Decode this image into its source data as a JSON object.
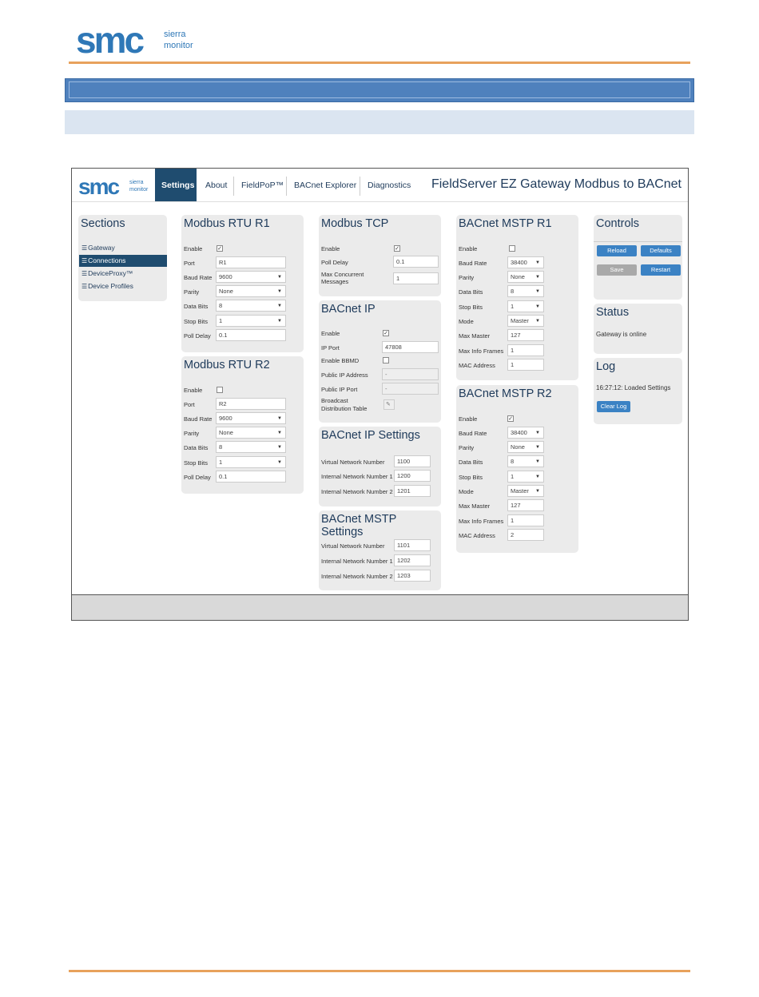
{
  "doc": {
    "logo_text": "smc",
    "logo_sub1": "sierra",
    "logo_sub2": "monitor"
  },
  "app": {
    "logo_text": "smc",
    "logo_sub1": "sierra",
    "logo_sub2": "monitor",
    "title": "FieldServer EZ Gateway Modbus to BACnet",
    "nav": [
      "Settings",
      "About",
      "FieldPoP™",
      "BACnet Explorer",
      "Diagnostics"
    ]
  },
  "sections": {
    "title": "Sections",
    "items": [
      "Gateway",
      "Connections",
      "DeviceProxy™",
      "Device Profiles"
    ]
  },
  "rtu1": {
    "title": "Modbus RTU R1",
    "labels": [
      "Enable",
      "Port",
      "Baud Rate",
      "Parity",
      "Data Bits",
      "Stop Bits",
      "Poll Delay"
    ],
    "enable": "✓",
    "port": "R1",
    "baud": "9600",
    "parity": "None",
    "data_bits": "8",
    "stop_bits": "1",
    "poll_delay": "0.1"
  },
  "rtu2": {
    "title": "Modbus RTU R2",
    "labels": [
      "Enable",
      "Port",
      "Baud Rate",
      "Parity",
      "Data Bits",
      "Stop Bits",
      "Poll Delay"
    ],
    "enable": "",
    "port": "R2",
    "baud": "9600",
    "parity": "None",
    "data_bits": "8",
    "stop_bits": "1",
    "poll_delay": "0.1"
  },
  "tcp": {
    "title": "Modbus TCP",
    "labels": [
      "Enable",
      "Poll Delay",
      "Max Concurrent",
      "Messages"
    ],
    "enable": "✓",
    "poll_delay": "0.1",
    "max_concurrent": "1"
  },
  "bip": {
    "title": "BACnet IP",
    "labels": [
      "Enable",
      "IP Port",
      "Enable BBMD",
      "Public IP Address",
      "Public IP Port",
      "Broadcast",
      "Distribution Table"
    ],
    "enable": "✓",
    "ip_port": "47808",
    "bbmd": "",
    "public_ip": "-",
    "public_port": "-",
    "bdt": "✎"
  },
  "bips": {
    "title": "BACnet IP Settings",
    "labels": [
      "Virtual Network Number",
      "Internal Network Number 1",
      "Internal Network Number 2"
    ],
    "values": [
      "1100",
      "1200",
      "1201"
    ]
  },
  "bms": {
    "title": "BACnet MSTP Settings",
    "labels": [
      "Virtual Network Number",
      "Internal Network Number 1",
      "Internal Network Number 2"
    ],
    "values": [
      "1101",
      "1202",
      "1203"
    ]
  },
  "mstp1": {
    "title": "BACnet MSTP R1",
    "labels": [
      "Enable",
      "Baud Rate",
      "Parity",
      "Data Bits",
      "Stop Bits",
      "Mode",
      "Max Master",
      "Max Info Frames",
      "MAC Address"
    ],
    "enable": "",
    "baud": "38400",
    "parity": "None",
    "data_bits": "8",
    "stop_bits": "1",
    "mode": "Master",
    "max_master": "127",
    "max_info": "1",
    "mac": "1"
  },
  "mstp2": {
    "title": "BACnet MSTP R2",
    "labels": [
      "Enable",
      "Baud Rate",
      "Parity",
      "Data Bits",
      "Stop Bits",
      "Mode",
      "Max Master",
      "Max Info Frames",
      "MAC Address"
    ],
    "enable": "✓",
    "baud": "38400",
    "parity": "None",
    "data_bits": "8",
    "stop_bits": "1",
    "mode": "Master",
    "max_master": "127",
    "max_info": "1",
    "mac": "2"
  },
  "controls": {
    "title": "Controls",
    "reload": "Reload",
    "defaults": "Defaults",
    "save": "Save",
    "restart": "Restart"
  },
  "status": {
    "title": "Status",
    "text": "Gateway is online"
  },
  "log": {
    "title": "Log",
    "text": "16:27:12: Loaded Settings",
    "clear": "Clear Log"
  },
  "colors": {
    "accent": "#1f4c6f",
    "button": "#3b82c4",
    "rule": "#e8a25c",
    "doc_bar": "#4f81bd"
  }
}
